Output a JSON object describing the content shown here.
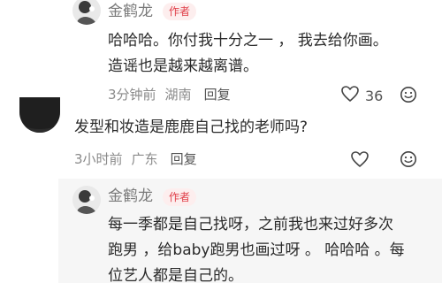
{
  "comments": [
    {
      "author": "金鹤龙",
      "badge": "作者",
      "lines": [
        "哈哈哈。你付我十分之一 ， 我去给你画。",
        "造谣也是越来越离谱。"
      ],
      "time": "3分钟前",
      "location": "湖南",
      "reply_label": "回复",
      "likes": "36"
    },
    {
      "text": "发型和妆造是鹿鹿自己找的老师吗?",
      "time": "3小时前",
      "location": "广东",
      "reply_label": "回复"
    }
  ],
  "nested_reply": {
    "author": "金鹤龙",
    "badge": "作者",
    "lines": [
      "每一季都是自己找呀，之前我也来过好多次",
      "跑男 ，给baby跑男也画过呀 。 哈哈哈 。每",
      "位艺人都是自己的。"
    ]
  },
  "icons": {
    "like": "heart-outline-icon",
    "more": "smiley-icon"
  },
  "colors": {
    "badge_text": "#e0404a",
    "badge_bg": "#fdeeee",
    "meta": "#8a8a8a",
    "reply_bg": "#f6f6f6"
  }
}
